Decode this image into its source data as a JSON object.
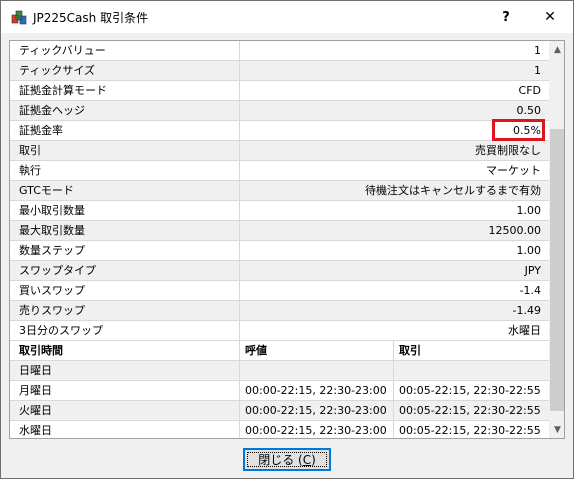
{
  "window": {
    "title": "JP225Cash 取引条件",
    "help_glyph": "?",
    "close_glyph": "✕",
    "icon": "app-logo-icon"
  },
  "properties": [
    {
      "key": "ティックバリュー",
      "value": "1"
    },
    {
      "key": "ティックサイズ",
      "value": "1"
    },
    {
      "key": "証拠金計算モード",
      "value": "CFD"
    },
    {
      "key": "証拠金ヘッジ",
      "value": "0.50"
    },
    {
      "key": "証拠金率",
      "value": "0.5%"
    },
    {
      "key": "取引",
      "value": "売買制限なし"
    },
    {
      "key": "執行",
      "value": "マーケット"
    },
    {
      "key": "GTCモード",
      "value": "待機注文はキャンセルするまで有効"
    },
    {
      "key": "最小取引数量",
      "value": "1.00"
    },
    {
      "key": "最大取引数量",
      "value": "12500.00"
    },
    {
      "key": "数量ステップ",
      "value": "1.00"
    },
    {
      "key": "スワップタイプ",
      "value": "JPY"
    },
    {
      "key": "買いスワップ",
      "value": "-1.4"
    },
    {
      "key": "売りスワップ",
      "value": "-1.49"
    },
    {
      "key": "3日分のスワップ",
      "value": "水曜日"
    }
  ],
  "sessions_header": {
    "c1": "取引時間",
    "c2": "呼値",
    "c3": "取引"
  },
  "sessions": [
    {
      "day": "日曜日",
      "quotes": "",
      "trades": ""
    },
    {
      "day": "月曜日",
      "quotes": "00:00-22:15, 22:30-23:00",
      "trades": "00:05-22:15, 22:30-22:55"
    },
    {
      "day": "火曜日",
      "quotes": "00:00-22:15, 22:30-23:00",
      "trades": "00:05-22:15, 22:30-22:55"
    },
    {
      "day": "水曜日",
      "quotes": "00:00-22:15, 22:30-23:00",
      "trades": "00:05-22:15, 22:30-22:55"
    }
  ],
  "scrollbar": {
    "up_glyph": "▲",
    "down_glyph": "▼"
  },
  "buttons": {
    "close_label": "閉じる (",
    "close_accel": "C",
    "close_suffix": ")"
  }
}
